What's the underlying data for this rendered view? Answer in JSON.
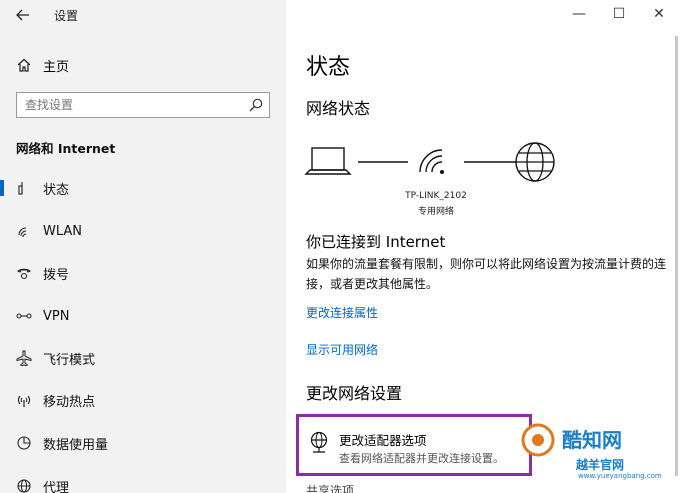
{
  "window": {
    "title": "设置",
    "controls": {
      "minimize": "—",
      "maximize": "☐",
      "close": "✕"
    }
  },
  "sidebar": {
    "back_icon": "arrow-left-icon",
    "home_label": "主页",
    "search_placeholder": "查找设置",
    "section_heading": "网络和 Internet",
    "items": [
      {
        "label": "状态",
        "icon": "status-icon",
        "active": true
      },
      {
        "label": "WLAN",
        "icon": "wifi-icon"
      },
      {
        "label": "拨号",
        "icon": "dialup-icon"
      },
      {
        "label": "VPN",
        "icon": "vpn-icon"
      },
      {
        "label": "飞行模式",
        "icon": "airplane-icon"
      },
      {
        "label": "移动热点",
        "icon": "hotspot-icon"
      },
      {
        "label": "数据使用量",
        "icon": "data-usage-icon"
      },
      {
        "label": "代理",
        "icon": "globe-icon"
      }
    ]
  },
  "main": {
    "title": "状态",
    "network_status_title": "网络状态",
    "ssid": "TP-LINK_2102",
    "network_type": "专用网络",
    "connected_title": "你已连接到 Internet",
    "connected_desc": "如果你的流量套餐有限制，则你可以将此网络设置为按流量计费的连接，或者更改其他属性。",
    "link_change_props": "更改连接属性",
    "link_show_networks": "显示可用网络",
    "change_settings_title": "更改网络设置",
    "adapter": {
      "title": "更改适配器选项",
      "desc": "查看网络适配器并更改连接设置。"
    },
    "next_item": "共享选项"
  },
  "watermark": {
    "line1": "酷知网",
    "line2": "越羊官网",
    "line3": "www.yueyangbang.com"
  }
}
